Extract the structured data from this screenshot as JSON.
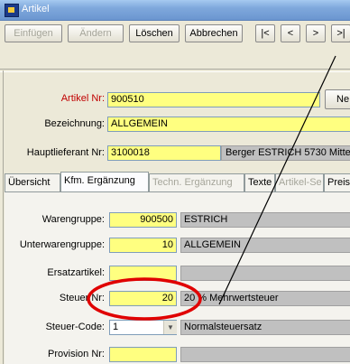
{
  "window": {
    "title": "Artikel"
  },
  "toolbar": {
    "insert": "Einfügen",
    "change": "Ändern",
    "delete": "Löschen",
    "cancel": "Abbrechen",
    "first": "|<",
    "prev": "<",
    "next": ">",
    "last": ">|"
  },
  "header": {
    "artikel_nr_label": "Artikel Nr:",
    "artikel_nr_value": "900510",
    "new_button": "Ne",
    "bezeichnung_label": "Bezeichnung:",
    "bezeichnung_value": "ALLGEMEIN",
    "hauptlieferant_label": "Hauptlieferant Nr:",
    "hauptlieferant_value": "3100018",
    "hauptlieferant_name": "Berger ESTRICH 5730 Mitte"
  },
  "tabs": [
    "Übersicht",
    "Kfm. Ergänzung",
    "Techn. Ergänzung",
    "Texte",
    "Artikel-Se",
    "Preise"
  ],
  "form": {
    "warengruppe_label": "Warengruppe:",
    "warengruppe_value": "900500",
    "warengruppe_text": "ESTRICH",
    "unterwarengruppe_label": "Unterwarengruppe:",
    "unterwarengruppe_value": "10",
    "unterwarengruppe_text": "ALLGEMEIN",
    "ersatzartikel_label": "Ersatzartikel:",
    "steuer_nr_label": "Steuer Nr:",
    "steuer_nr_value": "20",
    "steuer_nr_text": "20 % Mehrwertsteuer",
    "steuer_code_label": "Steuer-Code:",
    "steuer_code_value": "1",
    "steuer_code_text": "Normalsteuersatz",
    "provision_label": "Provision Nr:"
  },
  "colors": {
    "field_yellow": "#ffff80",
    "annotation_red": "#e00000",
    "label_red": "#c00000"
  }
}
